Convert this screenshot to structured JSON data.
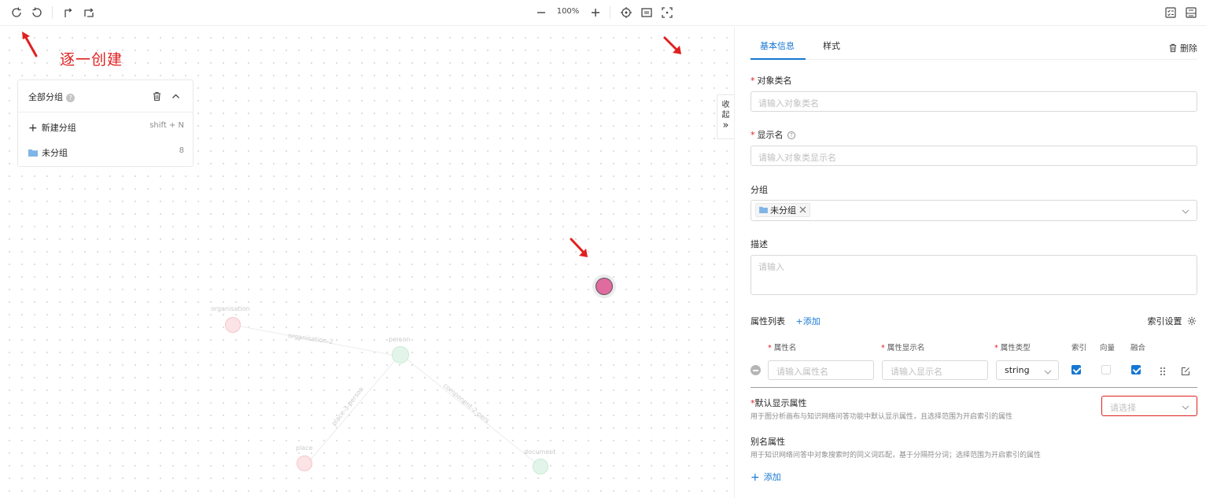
{
  "toolbar": {
    "zoom": "100%",
    "icons": [
      "undo-icon",
      "redo-icon",
      "edge-icon",
      "edge-switch-icon",
      "zoom-out-icon",
      "zoom-in-icon",
      "locate-icon",
      "fit-icon",
      "fullscreen-icon",
      "checklist-icon",
      "panel-icon"
    ]
  },
  "canvas": {
    "annotation": "逐一创建",
    "group_panel": {
      "title": "全部分组",
      "new_group": "新建分组",
      "shortcut": "shift + N",
      "groups": [
        {
          "name": "未分组",
          "count": "8"
        }
      ]
    },
    "collapse": {
      "line1": "收",
      "line2": "起",
      "icon": "»"
    },
    "faded_labels": [
      "organisation",
      "organisation-2",
      "person",
      "place-3-person",
      "component-2-pers",
      "place",
      "document"
    ],
    "node_color": "#e06c9f"
  },
  "panel": {
    "tabs": [
      "基本信息",
      "样式"
    ],
    "delete": "删除",
    "object_class_name": {
      "label": "对象类名",
      "placeholder": "请输入对象类名"
    },
    "display_name": {
      "label": "显示名",
      "placeholder": "请输入对象类显示名"
    },
    "group": {
      "label": "分组",
      "tag": "未分组"
    },
    "description": {
      "label": "描述",
      "placeholder": "请输入"
    },
    "attributes": {
      "title": "属性列表",
      "add": "+添加",
      "index_settings": "索引设置",
      "columns": [
        "属性名",
        "属性显示名",
        "属性类型",
        "索引",
        "向量",
        "融合"
      ],
      "row": {
        "name_placeholder": "请输入属性名",
        "display_placeholder": "请输入显示名",
        "type": "string",
        "index": true,
        "vector": false,
        "fusion": true
      }
    },
    "default_display": {
      "label": "默认显示属性",
      "note": "用于图分析画布与知识网络问答功能中默认显示属性，且选择范围为开启索引的属性",
      "select_placeholder": "请选择"
    },
    "alias": {
      "label": "别名属性",
      "note": "用于知识网络问答中对象搜索时的同义词匹配，基于分隔符分词；选择范围为开启索引的属性",
      "add": "添加"
    },
    "accent_color": "#1677d2"
  }
}
